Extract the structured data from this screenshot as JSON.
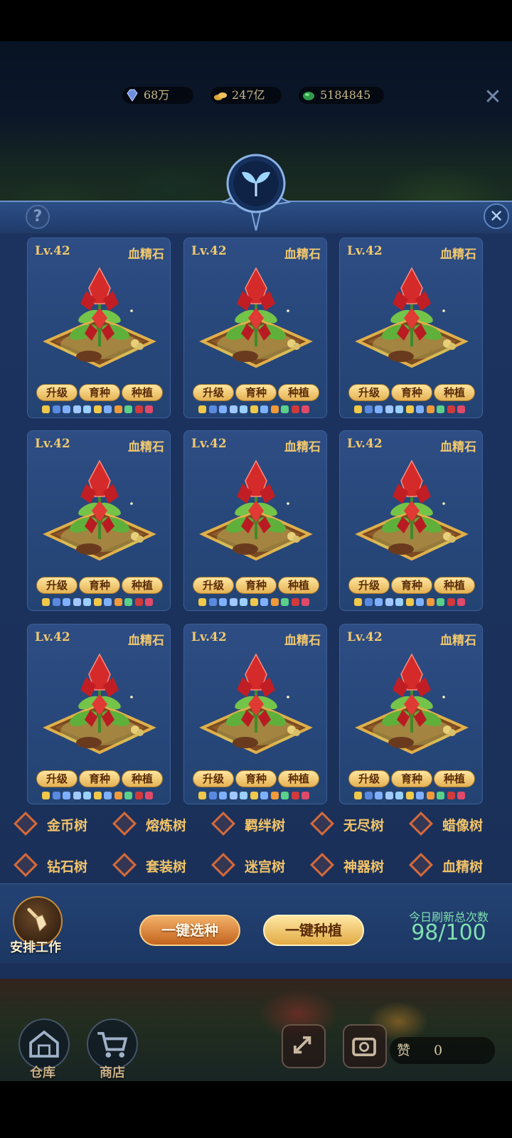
{
  "currency": {
    "diamond": "68万",
    "gold": "247亿",
    "jade": "5184845"
  },
  "cards": [
    {
      "level": "Lv.42",
      "kind": "血精石",
      "buttons": [
        "升级",
        "育种",
        "种植"
      ]
    },
    {
      "level": "Lv.42",
      "kind": "血精石",
      "buttons": [
        "升级",
        "育种",
        "种植"
      ]
    },
    {
      "level": "Lv.42",
      "kind": "血精石",
      "buttons": [
        "升级",
        "育种",
        "种植"
      ]
    },
    {
      "level": "Lv.42",
      "kind": "血精石",
      "buttons": [
        "升级",
        "育种",
        "种植"
      ]
    },
    {
      "level": "Lv.42",
      "kind": "血精石",
      "buttons": [
        "升级",
        "育种",
        "种植"
      ]
    },
    {
      "level": "Lv.42",
      "kind": "血精石",
      "buttons": [
        "升级",
        "育种",
        "种植"
      ]
    },
    {
      "level": "Lv.42",
      "kind": "血精石",
      "buttons": [
        "升级",
        "育种",
        "种植"
      ]
    },
    {
      "level": "Lv.42",
      "kind": "血精石",
      "buttons": [
        "升级",
        "育种",
        "种植"
      ]
    },
    {
      "level": "Lv.42",
      "kind": "血精石",
      "buttons": [
        "升级",
        "育种",
        "种植"
      ]
    }
  ],
  "trees": [
    "金币树",
    "熔炼树",
    "羁绊树",
    "无尽树",
    "蜡像树",
    "钻石树",
    "套装树",
    "迷宫树",
    "神器树",
    "血精树"
  ],
  "bottom": {
    "assign_work": "安排工作",
    "one_key_select": "一键选种",
    "one_key_plant": "一键种植",
    "refresh_label": "今日刷新总次数",
    "refresh_count": "98/100"
  },
  "hud": {
    "warehouse": "仓库",
    "shop": "商店",
    "like_label": "赞",
    "like_count": "0"
  },
  "colors": {
    "gold_text": "#f0c870",
    "panel_blue": "#1c3360",
    "accent_green": "#7fe0b0",
    "diamond_marker": "#d56a3a"
  }
}
